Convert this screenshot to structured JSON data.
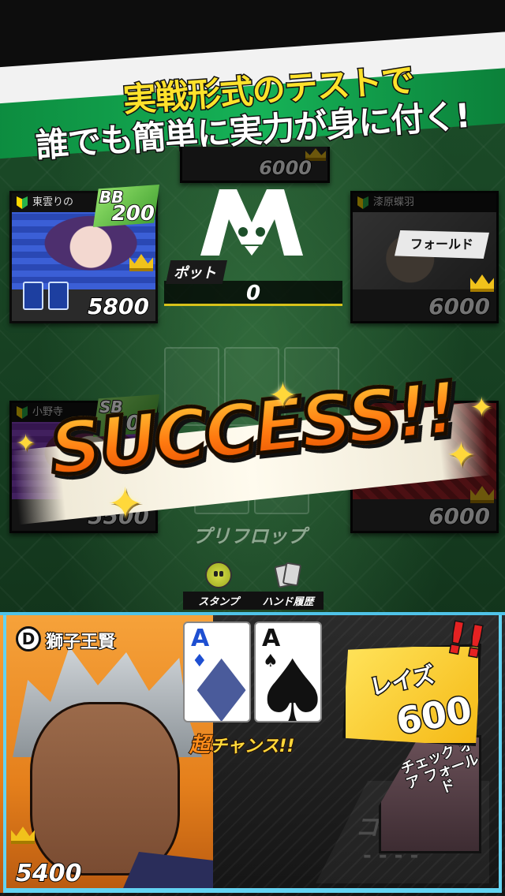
{
  "banner": {
    "line1": "実戦形式のテストで",
    "line2": "誰でも簡単に実力が身に付く!"
  },
  "opponents": {
    "top": {
      "chips": "6000"
    },
    "left_top": {
      "name": "東雲りの",
      "blind_label": "BB",
      "blind_value": "200",
      "chips": "5800"
    },
    "right_top": {
      "name": "漆原蝶羽",
      "action": "フォールド",
      "chips": "6000"
    },
    "left_bottom": {
      "name": "小野寺",
      "blind_label": "SB",
      "blind_value": "100",
      "chips": "5500"
    },
    "right_bottom": {
      "chips": "6000"
    }
  },
  "pot": {
    "label": "ポット",
    "value": "0"
  },
  "stage": {
    "label": "プリフロップ"
  },
  "overlay": {
    "success_text": "SUCCESS!!"
  },
  "actions": {
    "stamp_label": "スタンプ",
    "history_label": "ハンド履歴"
  },
  "player": {
    "dealer_marker": "D",
    "name": "獅子王賢",
    "chips": "5400",
    "cards": [
      {
        "rank": "A",
        "suit": "♦"
      },
      {
        "rank": "A",
        "suit": "♠"
      }
    ],
    "chance_prefix": "超",
    "chance_label": "チャンス!!"
  },
  "controls": {
    "raise_label": "レイズ",
    "raise_value": "600",
    "raise_excl": "!!",
    "check_fold_label": "チェック オア フォールド",
    "call_label": "コール",
    "call_value": "- - - -"
  },
  "colors": {
    "accent_frame": "#63d3f2",
    "headline_yellow": "#ffe22b",
    "success_orange": "#ff8a1a",
    "raise_yellow": "#f5b915"
  }
}
